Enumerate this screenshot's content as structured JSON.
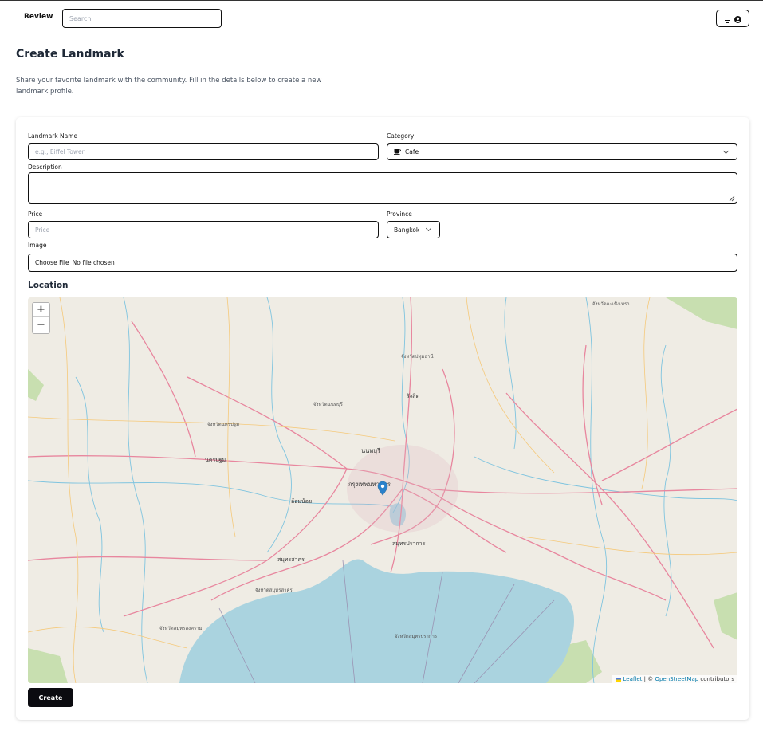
{
  "navbar": {
    "brand": "Review",
    "search_placeholder": "Search",
    "menu_icon": "list-icon",
    "user_icon": "user-circle-icon"
  },
  "page": {
    "title": "Create Landmark",
    "description": "Share your favorite landmark with the community. Fill in the details below to create a new landmark profile."
  },
  "form": {
    "name_label": "Landmark Name",
    "name_placeholder": "e.g., Eiffel Tower",
    "category_label": "Category",
    "category_value": "Cafe",
    "category_icon": "coffee-icon",
    "description_label": "Description",
    "price_label": "Price",
    "price_placeholder": "Price",
    "province_label": "Province",
    "province_value": "Bangkok",
    "image_label": "Image",
    "file_button": "Choose File",
    "file_status": "No file chosen",
    "location_heading": "Location",
    "submit_label": "Create"
  },
  "map": {
    "zoom_in": "+",
    "zoom_out": "−",
    "attribution_leaflet": "Leaflet",
    "attribution_sep": "| ©",
    "attribution_osm": "OpenStreetMap",
    "attribution_suffix": "contributors",
    "labels": [
      "จังหวัดนครปฐม",
      "จังหวัดนนทบุรี",
      "จังหวัดปทุมธานี",
      "นนทบุรี",
      "กรุงเทพมหานคร",
      "สมุทรปราการ",
      "สมุทรสาคร",
      "จังหวัดสมุทรปราการ",
      "จังหวัดสมุทรสาคร",
      "นครปฐม",
      "อ้อมน้อย",
      "รังสิต",
      "จังหวัดฉะเชิงเทรา",
      "จังหวัดสมุทรสงคราม"
    ],
    "colors": {
      "water": "#aad3df",
      "land": "#f2efe9",
      "road": "#e8869e",
      "green": "#c8dfb0"
    }
  }
}
